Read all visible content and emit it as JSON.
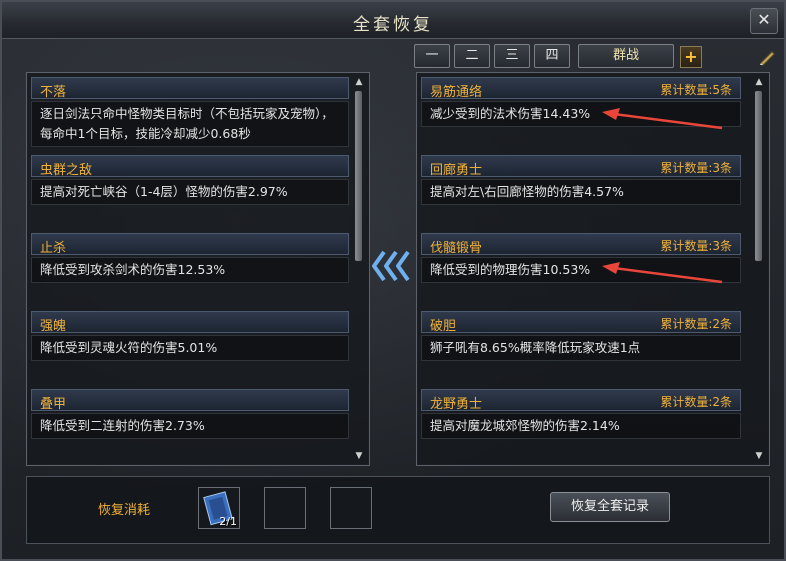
{
  "window": {
    "title": "全套恢复",
    "close": "✕"
  },
  "tabs": [
    "一",
    "二",
    "三",
    "四",
    "群战"
  ],
  "left_entries": [
    {
      "name": "不落",
      "desc": "逐日剑法只命中怪物类目标时（不包括玩家及宠物），每命中1个目标，技能冷却减少0.68秒"
    },
    {
      "name": "虫群之敌",
      "desc": "提高对死亡峡谷（1-4层）怪物的伤害2.97%"
    },
    {
      "name": "止杀",
      "desc": "降低受到攻杀剑术的伤害12.53%"
    },
    {
      "name": "强魄",
      "desc": "降低受到灵魂火符的伤害5.01%"
    },
    {
      "name": "叠甲",
      "desc": "降低受到二连射的伤害2.73%"
    }
  ],
  "right_entries": [
    {
      "name": "易筋通络",
      "count": "累计数量:5条",
      "desc": "减少受到的法术伤害14.43%"
    },
    {
      "name": "回廊勇士",
      "count": "累计数量:3条",
      "desc": "提高对左\\右回廊怪物的伤害4.57%"
    },
    {
      "name": "伐髓锻骨",
      "count": "累计数量:3条",
      "desc": "降低受到的物理伤害10.53%"
    },
    {
      "name": "破胆",
      "count": "累计数量:2条",
      "desc": "狮子吼有8.65%概率降低玩家攻速1点"
    },
    {
      "name": "龙野勇士",
      "count": "累计数量:2条",
      "desc": "提高对魔龙城郊怪物的伤害2.14%"
    }
  ],
  "bottom": {
    "cost_label": "恢复消耗",
    "slot_item_count": "2/1",
    "history_button": "恢复全套记录"
  },
  "icons": {
    "close": "close-icon",
    "plus": "plus-icon",
    "edit": "quill-icon",
    "transfer": "chevron-left-triple-icon",
    "scroll_item": "scroll-item-icon"
  },
  "colors": {
    "gold_text": "#f0b13a",
    "arrow_red": "#e8463a",
    "transfer_arrow": "#5a9fe0"
  }
}
